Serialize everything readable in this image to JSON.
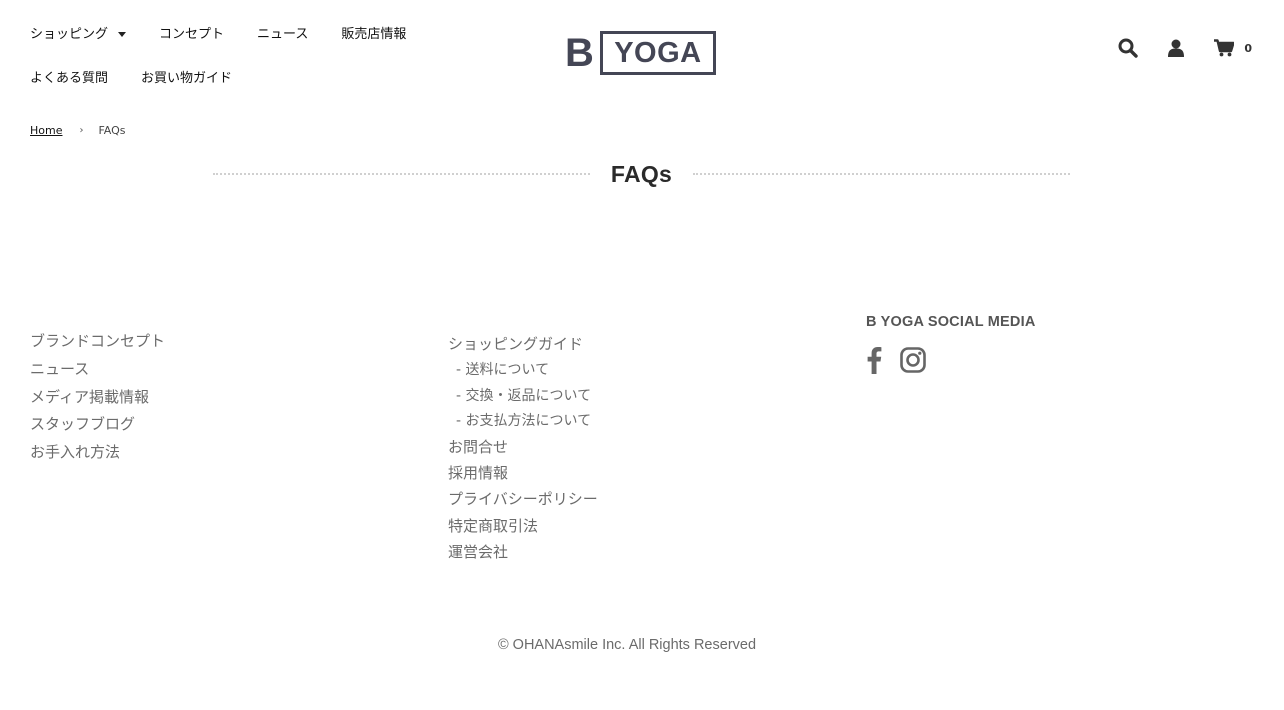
{
  "header": {
    "nav_row1": [
      {
        "label": "ショッピング",
        "has_dropdown": true
      },
      {
        "label": "コンセプト"
      },
      {
        "label": "ニュース"
      },
      {
        "label": "販売店情報"
      }
    ],
    "nav_row2": [
      {
        "label": "よくある質問"
      },
      {
        "label": "お買い物ガイド"
      }
    ],
    "logo_letter": "B",
    "logo_word": "YOGA",
    "cart_count": "0",
    "icons": [
      "search-icon",
      "user-icon",
      "cart-icon"
    ],
    "accent_color": "#444655"
  },
  "breadcrumb": {
    "home": "Home",
    "separator": "›",
    "current": "FAQs"
  },
  "page_title": "FAQs",
  "footer": {
    "col1": [
      "ブランドコンセプト",
      "ニュース",
      "メディア掲載情報",
      "スタッフブログ",
      "お手入れ方法"
    ],
    "col2": [
      {
        "label": "ショッピングガイド",
        "sub": false
      },
      {
        "label": "- 送料について",
        "sub": true
      },
      {
        "label": "- 交換・返品について",
        "sub": true
      },
      {
        "label": "- お支払方法について",
        "sub": true
      },
      {
        "label": "お問合せ",
        "sub": false
      },
      {
        "label": "採用情報",
        "sub": false
      },
      {
        "label": "プライバシーポリシー",
        "sub": false
      },
      {
        "label": "特定商取引法",
        "sub": false
      },
      {
        "label": "運営会社",
        "sub": false
      }
    ],
    "social_title": "B YOGA SOCIAL MEDIA",
    "social_icons": [
      "facebook-icon",
      "instagram-icon"
    ],
    "copyright": "© OHANAsmile Inc. All Rights Reserved"
  }
}
